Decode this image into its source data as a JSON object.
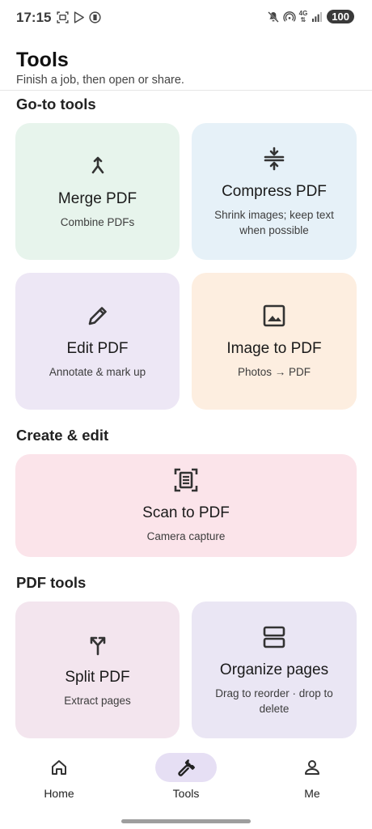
{
  "status": {
    "time": "17:15",
    "network": "4G",
    "battery": "100"
  },
  "header": {
    "title": "Tools",
    "subtitle": "Finish a job, then open or share."
  },
  "sections": {
    "goto": "Go-to tools",
    "create": "Create & edit",
    "pdf": "PDF tools"
  },
  "cards": {
    "merge": {
      "title": "Merge PDF",
      "subtitle": "Combine PDFs",
      "icon": "merge-icon",
      "bg": "#e7f4ec"
    },
    "compress": {
      "title": "Compress PDF",
      "subtitle": "Shrink images; keep text when possible",
      "icon": "compress-icon",
      "bg": "#e6f1f8"
    },
    "edit": {
      "title": "Edit PDF",
      "subtitle": "Annotate & mark up",
      "icon": "pencil-icon",
      "bg": "#ede7f5"
    },
    "image": {
      "title": "Image to PDF",
      "subtitle": "Photos → PDF",
      "icon": "image-icon",
      "bg": "#fdeee0"
    },
    "scan": {
      "title": "Scan to PDF",
      "subtitle": "Camera capture",
      "icon": "scan-icon",
      "bg": "#fbe4ea"
    },
    "split": {
      "title": "Split PDF",
      "subtitle": "Extract pages",
      "icon": "split-icon",
      "bg": "#f3e5ee"
    },
    "organize": {
      "title": "Organize pages",
      "subtitle": "Drag to reorder · drop to delete",
      "icon": "pages-icon",
      "bg": "#eae6f4"
    }
  },
  "nav": {
    "home": "Home",
    "tools": "Tools",
    "me": "Me",
    "active": "Tools"
  }
}
